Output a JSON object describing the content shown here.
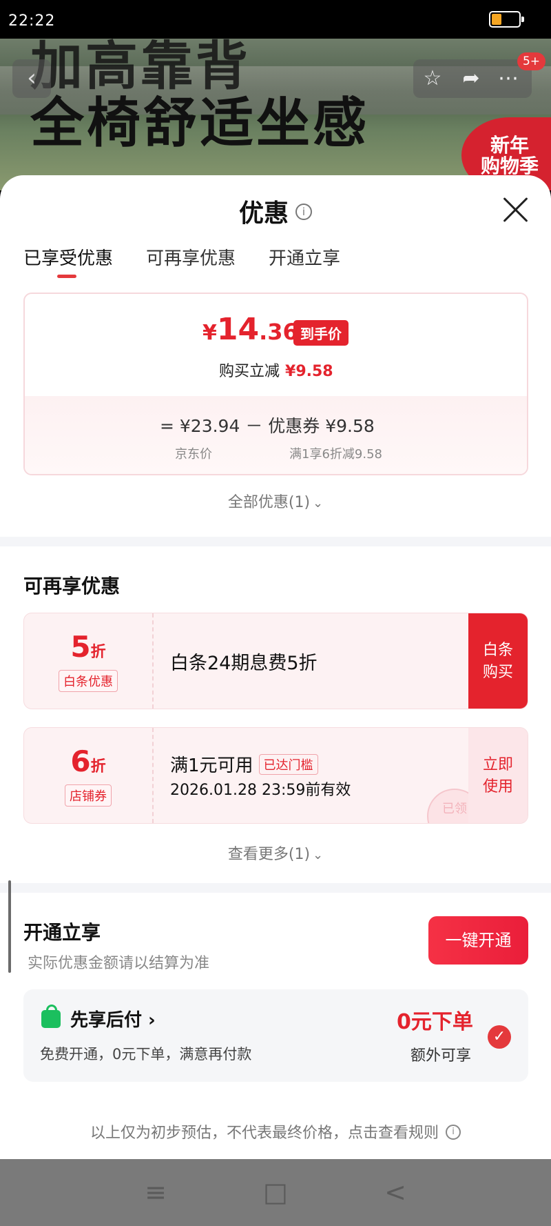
{
  "status_bar": {
    "time": "22:22"
  },
  "banner": {
    "headline_1": "加高靠背",
    "headline_2": "全椅舒适坐感",
    "back_glyph": "‹",
    "badge_count": "5+",
    "promo_badge": "新年\n购物季",
    "icons": [
      "back-icon",
      "star-icon",
      "share-icon",
      "more-icon"
    ]
  },
  "sheet": {
    "title": "优惠",
    "info_glyph": "i",
    "tabs": [
      {
        "label": "已享受优惠",
        "active": true
      },
      {
        "label": "可再享优惠",
        "active": false
      },
      {
        "label": "开通立享",
        "active": false
      }
    ]
  },
  "price_card": {
    "yen": "¥",
    "price_int": "14",
    "price_dec": ".36",
    "tag": "到手价",
    "reduce_label": "购买立减",
    "reduce_value": "¥9.58",
    "calc_line": "=  ¥23.94  －  优惠券 ¥9.58",
    "calc_left_label": "京东价",
    "calc_right_label": "满1享6折减9.58"
  },
  "all_offers": {
    "label": "全部优惠(1)",
    "chevron": "⌄"
  },
  "more_offers": {
    "title": "可再享优惠",
    "coupons": [
      {
        "discount_num": "5",
        "discount_unit": "折",
        "chip": "白条优惠",
        "description": "白条24期息费5折",
        "action": "白条\n购买"
      },
      {
        "discount_num": "6",
        "discount_unit": "折",
        "chip": "店铺券",
        "line1": "满1元可用",
        "line1_chip": "已达门槛",
        "line2": "2026.01.28 23:59前有效",
        "action": "立即\n使用",
        "stamp": "已领"
      }
    ],
    "see_more": "查看更多(1)"
  },
  "open_section": {
    "title": "开通立享",
    "subtitle": "实际优惠金额请以结算为准",
    "button": "一键开通"
  },
  "pay_later": {
    "title": "先享后付 ›",
    "subtitle": "免费开通，0元下单，满意再付款",
    "zero": "0元下单",
    "extra": "额外可享",
    "check": "✓"
  },
  "disclaimer": "以上仅为初步预估，不代表最终价格，点击查看规则",
  "colors": {
    "accent": "#e4232d",
    "green": "#1bbf5e"
  },
  "system_nav": {
    "menu": "≡",
    "home": "□",
    "back": "<"
  }
}
